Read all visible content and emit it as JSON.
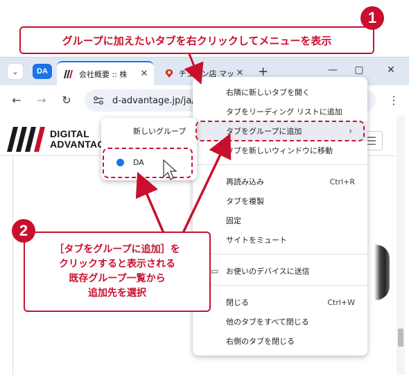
{
  "annotations": {
    "step1_number": "1",
    "step1_text": "グループに加えたいタブを右クリックしてメニューを表示",
    "step2_number": "2",
    "step2_lines": [
      "［タブをグループに追加］を",
      "クリックすると表示される",
      "既存グループ一覧から",
      "追加先を選択"
    ],
    "accent_color": "#c8102e"
  },
  "browser": {
    "tab_group_chip": "DA",
    "tab_group_color": "#1a73e8",
    "tabs": [
      {
        "title": "会社概要 :: 株",
        "close": "✕",
        "active": true
      },
      {
        "title": "チェーン店 マップ",
        "close": "✕",
        "active": false
      }
    ],
    "new_tab": "+",
    "window_controls": {
      "minimize": "—",
      "maximize": "▢",
      "close": "✕"
    },
    "url": "d-advantage.jp/ja/c"
  },
  "page": {
    "logo_line1": "DIGITAL",
    "logo_line2": "ADVANTAG"
  },
  "context_menu": {
    "items": [
      {
        "label": "右隣に新しいタブを開く"
      },
      {
        "label": "タブをリーディング リストに追加"
      },
      {
        "label": "タブをグループに追加",
        "arrow": "›"
      },
      {
        "label": "タブを新しいウィンドウに移動"
      },
      {
        "label": "再読み込み",
        "shortcut": "Ctrl+R"
      },
      {
        "label": "タブを複製"
      },
      {
        "label": "固定"
      },
      {
        "label": "サイトをミュート"
      },
      {
        "label": "お使いのデバイスに送信"
      },
      {
        "label": "閉じる",
        "shortcut": "Ctrl+W"
      },
      {
        "label": "他のタブをすべて閉じる"
      },
      {
        "label": "右側のタブを閉じる"
      }
    ]
  },
  "submenu": {
    "new_group": "新しいグループ",
    "groups": [
      {
        "label": "DA",
        "color": "#1a73e8"
      }
    ]
  }
}
